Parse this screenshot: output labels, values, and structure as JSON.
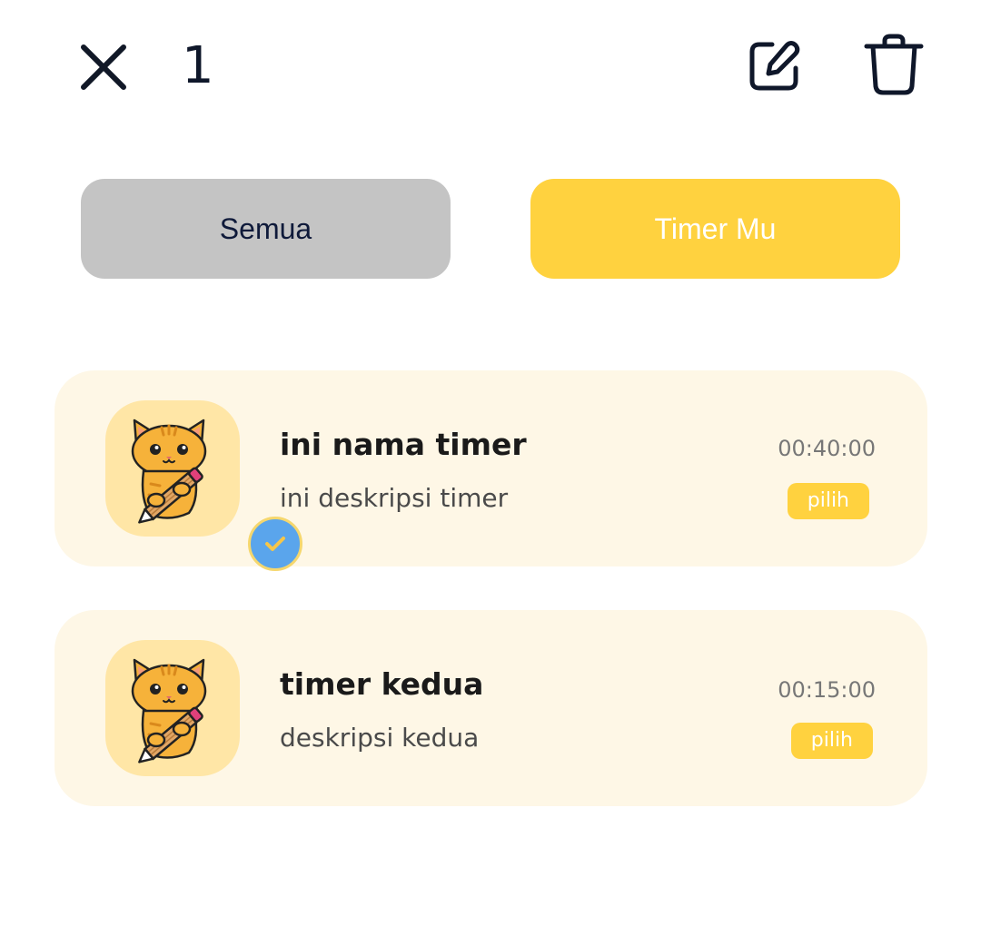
{
  "header": {
    "selected_count": "1"
  },
  "tabs": {
    "all_label": "Semua",
    "mine_label": "Timer Mu"
  },
  "timers": [
    {
      "name": "ini nama timer",
      "description": "ini deskripsi timer",
      "duration": "00:40:00",
      "pick_label": "pilih",
      "selected": true
    },
    {
      "name": "timer kedua",
      "description": "deskripsi kedua",
      "duration": "00:15:00",
      "pick_label": "pilih",
      "selected": false
    }
  ],
  "icons": {
    "close": "close-icon",
    "edit": "edit-icon",
    "delete": "trash-icon",
    "check": "check-icon",
    "avatar": "cat-with-pencil-icon"
  },
  "colors": {
    "accent": "#ffd23f",
    "tab_inactive": "#c4c4c4",
    "card_bg": "#fef7e6",
    "avatar_bg": "#ffe6a6",
    "check_badge": "#5aa5ec"
  }
}
